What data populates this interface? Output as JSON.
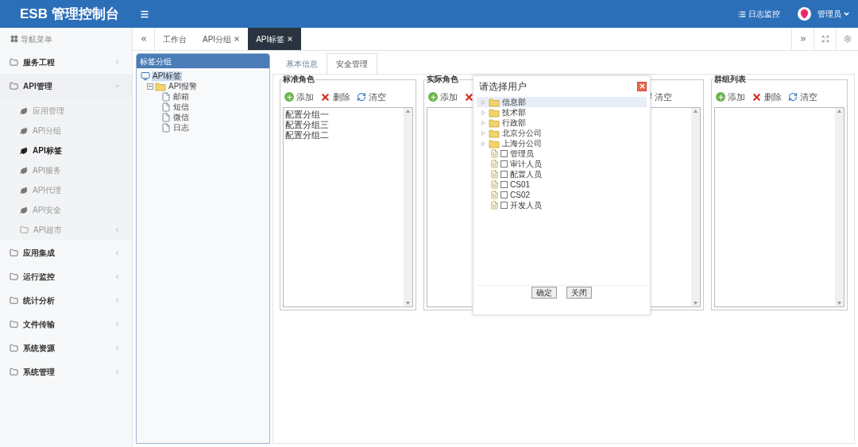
{
  "header": {
    "title": "ESB 管理控制台",
    "links": [
      {
        "label": "日志监控"
      }
    ],
    "user": "管理员"
  },
  "sidebar": {
    "title": "导航菜单",
    "items": [
      {
        "label": "服务工程",
        "expanded": false
      },
      {
        "label": "API管理",
        "expanded": true,
        "children": [
          {
            "label": "应用管理",
            "kind": "leaf",
            "selected": false
          },
          {
            "label": "API分组",
            "kind": "leaf",
            "selected": false
          },
          {
            "label": "API标签",
            "kind": "leaf",
            "selected": true
          },
          {
            "label": "API服务",
            "kind": "leaf",
            "selected": false
          },
          {
            "label": "API代理",
            "kind": "leaf",
            "selected": false
          },
          {
            "label": "API安全",
            "kind": "leaf",
            "selected": false
          },
          {
            "label": "API超市",
            "kind": "folder",
            "selected": false
          }
        ]
      },
      {
        "label": "应用集成",
        "expanded": false
      },
      {
        "label": "运行监控",
        "expanded": false
      },
      {
        "label": "统计分析",
        "expanded": false
      },
      {
        "label": "文件传输",
        "expanded": false
      },
      {
        "label": "系统资源",
        "expanded": false
      },
      {
        "label": "系统管理",
        "expanded": false
      }
    ]
  },
  "tabs": [
    {
      "label": "工作台",
      "closable": false,
      "selected": false
    },
    {
      "label": "API分组",
      "closable": true,
      "selected": false
    },
    {
      "label": "API标签",
      "closable": true,
      "selected": true
    }
  ],
  "tree_panel": {
    "title": "标签分组",
    "tree": [
      {
        "label": "API标签",
        "kind": "root",
        "selected": true,
        "children": [
          {
            "label": "API报警",
            "kind": "folder",
            "expanded": true,
            "selected": false,
            "children": [
              {
                "label": "邮箱",
                "kind": "file",
                "selected": false
              },
              {
                "label": "短信",
                "kind": "file",
                "selected": false
              },
              {
                "label": "微信",
                "kind": "file",
                "selected": false
              },
              {
                "label": "日志",
                "kind": "file",
                "selected": false
              }
            ]
          }
        ]
      }
    ]
  },
  "content_tabs": [
    {
      "label": "基本信息",
      "selected": false
    },
    {
      "label": "安全管理",
      "selected": true
    }
  ],
  "panels": [
    {
      "legend": "标准角色",
      "toolbar": [
        {
          "kind": "add",
          "label": "添加"
        },
        {
          "kind": "delete",
          "label": "删除"
        },
        {
          "kind": "clear",
          "label": "清空"
        }
      ],
      "items": [
        "配置分组一",
        "配置分组三",
        "配置分组二"
      ]
    },
    {
      "legend": "实际角色",
      "toolbar": [
        {
          "kind": "add",
          "label": "添加"
        },
        {
          "kind": "delete"
        }
      ]
    },
    {
      "toolbar": [
        {
          "kind": "clear",
          "label": "清空"
        }
      ]
    },
    {
      "legend": "群组列表",
      "toolbar": [
        {
          "kind": "add",
          "label": "添加"
        },
        {
          "kind": "delete",
          "label": "删除"
        },
        {
          "kind": "clear",
          "label": "清空"
        }
      ]
    }
  ],
  "dialog": {
    "title": "请选择用户",
    "tree": [
      {
        "label": "信息部",
        "kind": "folder",
        "expanded": false,
        "selected": true
      },
      {
        "label": "技术部",
        "kind": "folder",
        "expanded": false,
        "selected": false
      },
      {
        "label": "行政部",
        "kind": "folder",
        "expanded": false,
        "selected": false
      },
      {
        "label": "北京分公司",
        "kind": "folder",
        "expanded": false,
        "selected": false
      },
      {
        "label": "上海分公司",
        "kind": "folder",
        "expanded": false,
        "selected": false
      },
      {
        "label": "管理员",
        "kind": "user",
        "checked": false,
        "selected": false
      },
      {
        "label": "审计人员",
        "kind": "user",
        "checked": false,
        "selected": false
      },
      {
        "label": "配置人员",
        "kind": "user",
        "checked": false,
        "selected": false
      },
      {
        "label": "CS01",
        "kind": "user",
        "checked": false,
        "selected": false
      },
      {
        "label": "CS02",
        "kind": "user",
        "checked": false,
        "selected": false
      },
      {
        "label": "开发人员",
        "kind": "user",
        "checked": false,
        "selected": false
      }
    ],
    "buttons": [
      "确定",
      "关闭"
    ]
  }
}
